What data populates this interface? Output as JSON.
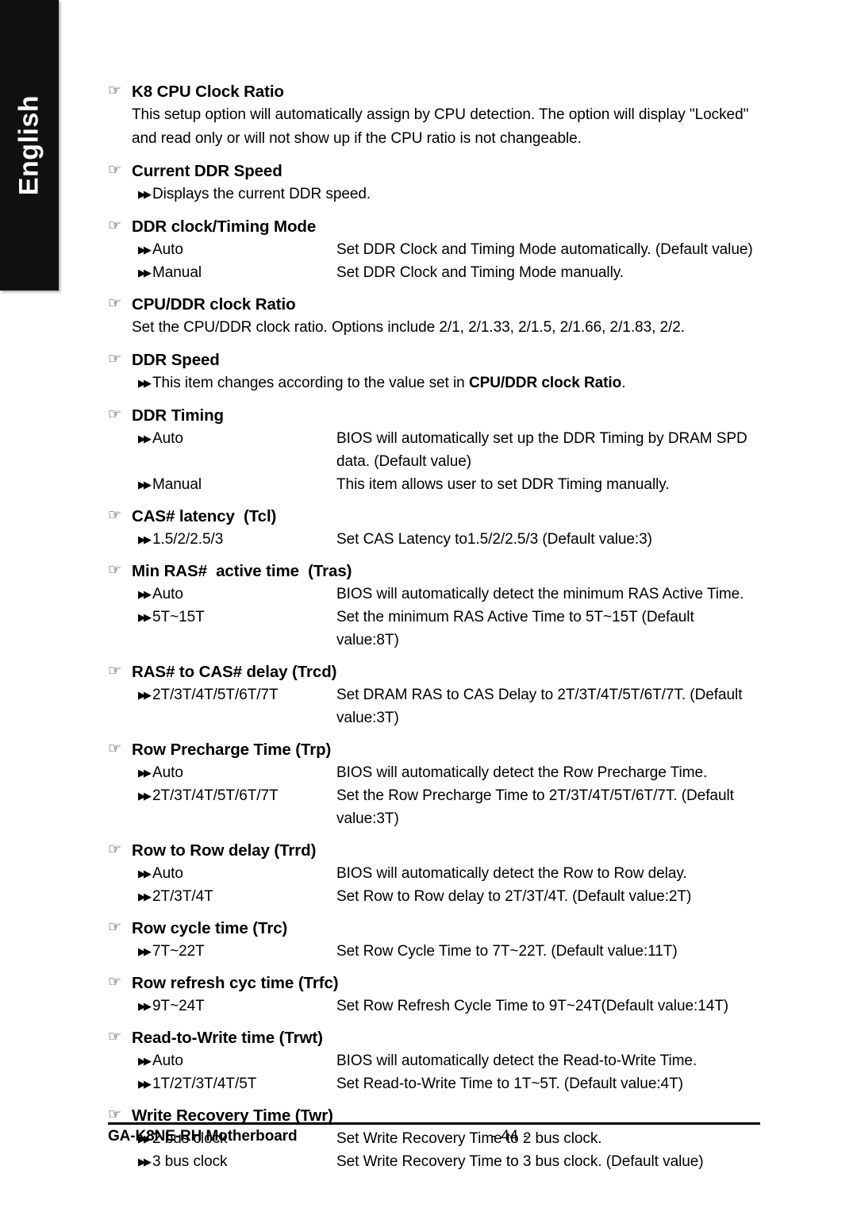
{
  "language_tab": {
    "label": "English"
  },
  "icons": {
    "section_bullet": "pointing-hand-icon",
    "option_bullet": "double-arrow-icon",
    "section_bullet_glyph": "☞",
    "option_bullet_glyph": "▶▶"
  },
  "sections": [
    {
      "title": "K8 CPU Clock Ratio",
      "paragraph": "This setup option will automatically assign by CPU detection. The option will display \"Locked\" and read only or will not show up if the CPU ratio is not changeable."
    },
    {
      "title": "Current DDR Speed",
      "note": "Displays the current DDR speed."
    },
    {
      "title": "DDR clock/Timing Mode",
      "options": [
        {
          "name": "Auto",
          "desc": "Set DDR Clock and Timing Mode automatically. (Default value)"
        },
        {
          "name": "Manual",
          "desc": "Set DDR Clock and Timing Mode manually."
        }
      ]
    },
    {
      "title": "CPU/DDR clock Ratio",
      "paragraph": "Set the CPU/DDR clock ratio. Options include 2/1, 2/1.33, 2/1.5, 2/1.66, 2/1.83, 2/2."
    },
    {
      "title": "DDR Speed",
      "note_prefix": "This item changes according to the value set in ",
      "note_bold": "CPU/DDR clock Ratio",
      "note_suffix": "."
    },
    {
      "title": "DDR Timing",
      "options": [
        {
          "name": "Auto",
          "desc": "BIOS will automatically set up the DDR Timing by DRAM SPD",
          "desc_cont": "data. (Default value)"
        },
        {
          "name": "Manual",
          "desc": "This item allows user to set DDR Timing manually."
        }
      ]
    },
    {
      "title": "CAS# latency  (Tcl)",
      "options": [
        {
          "name": "1.5/2/2.5/3",
          "desc": "Set CAS Latency to1.5/2/2.5/3 (Default value:3)"
        }
      ]
    },
    {
      "title": "Min RAS#  active time  (Tras)",
      "options": [
        {
          "name": "Auto",
          "desc": "BIOS will automatically detect the minimum RAS Active Time."
        },
        {
          "name": "5T~15T",
          "desc": "Set the minimum RAS Active Time to 5T~15T (Default value:8T)"
        }
      ]
    },
    {
      "title": "RAS# to CAS# delay (Trcd)",
      "options": [
        {
          "name": "2T/3T/4T/5T/6T/7T",
          "desc": "Set DRAM RAS to CAS Delay to 2T/3T/4T/5T/6T/7T. (Default",
          "desc_cont": "value:3T)"
        }
      ]
    },
    {
      "title": "Row Precharge Time (Trp)",
      "options": [
        {
          "name": "Auto",
          "desc": "BIOS will automatically detect the Row Precharge Time."
        },
        {
          "name": "2T/3T/4T/5T/6T/7T",
          "desc": "Set the Row Precharge Time to 2T/3T/4T/5T/6T/7T. (Default",
          "desc_cont": "value:3T)"
        }
      ]
    },
    {
      "title": "Row to Row delay (Trrd)",
      "options": [
        {
          "name": "Auto",
          "desc": "BIOS will automatically detect the Row to Row delay."
        },
        {
          "name": "2T/3T/4T",
          "desc": "Set Row to Row delay to 2T/3T/4T. (Default value:2T)"
        }
      ]
    },
    {
      "title": "Row cycle time (Trc)",
      "options": [
        {
          "name": "7T~22T",
          "desc": "Set Row Cycle Time to 7T~22T. (Default value:11T)"
        }
      ]
    },
    {
      "title": "Row refresh cyc time (Trfc)",
      "options": [
        {
          "name": "9T~24T",
          "desc": "Set Row Refresh Cycle Time to 9T~24T(Default value:14T)"
        }
      ]
    },
    {
      "title": "Read-to-Write time (Trwt)",
      "options": [
        {
          "name": "Auto",
          "desc": "BIOS will automatically detect the Read-to-Write Time."
        },
        {
          "name": "1T/2T/3T/4T/5T",
          "desc": "Set Read-to-Write Time to 1T~5T. (Default value:4T)"
        }
      ]
    },
    {
      "title": "Write Recovery Time (Twr)",
      "options": [
        {
          "name": "2 bus clock",
          "desc": "Set Write Recovery Time to 2 bus clock."
        },
        {
          "name": "3 bus clock",
          "desc": "Set Write Recovery Time to 3 bus clock. (Default value)"
        }
      ]
    }
  ],
  "footer": {
    "product": "GA-K8NE-RH Motherboard",
    "page_number": "- 44 -"
  }
}
